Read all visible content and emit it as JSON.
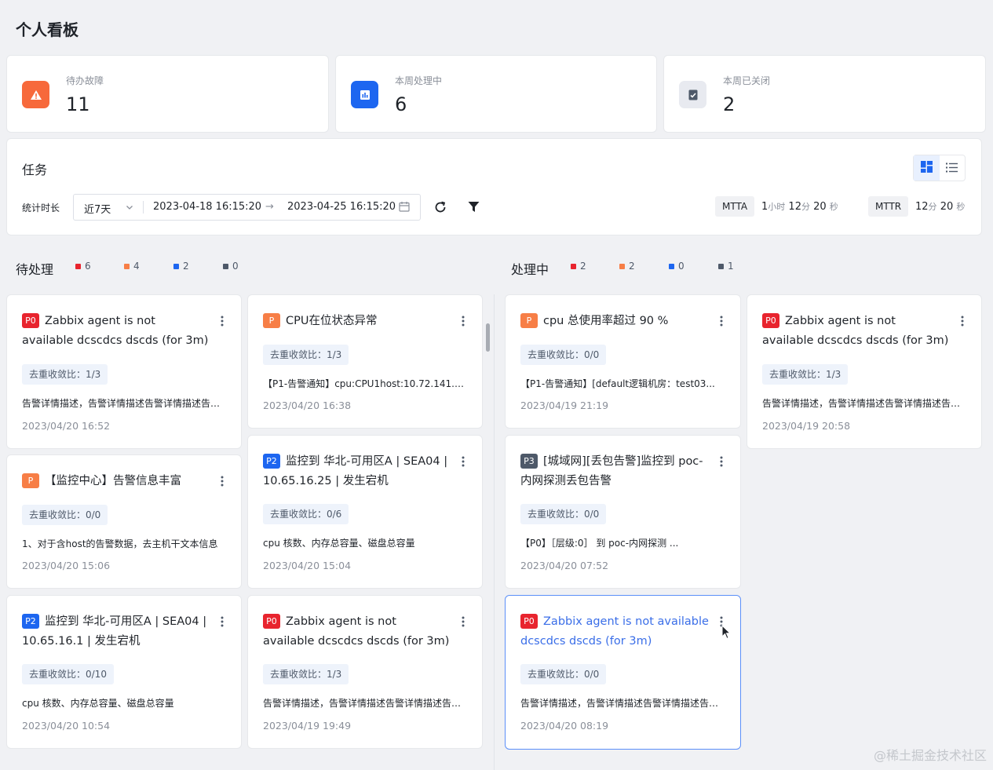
{
  "page_title": "个人看板",
  "stats": [
    {
      "label": "待办故障",
      "value": "11",
      "icon": "warning-icon",
      "color": "#f7693b"
    },
    {
      "label": "本周处理中",
      "value": "6",
      "icon": "chart-icon",
      "color": "#1d66f0"
    },
    {
      "label": "本周已关闭",
      "value": "2",
      "icon": "clipboard-check-icon",
      "color": "#e8eaf0"
    }
  ],
  "task": {
    "title": "任务",
    "filter_label": "统计时长",
    "range_select": "近7天",
    "start": "2023-04-18 16:15:20",
    "arrow": "→",
    "end": "2023-04-25 16:15:20",
    "mtta_label": "MTTA",
    "mtta": {
      "h": "1",
      "h_unit": "小时",
      "m": "12",
      "m_unit": "分",
      "s": "20",
      "s_unit": "秒"
    },
    "mttr_label": "MTTR",
    "mttr": {
      "m": "12",
      "m_unit": "分",
      "s": "20",
      "s_unit": "秒"
    }
  },
  "columns": [
    {
      "title": "待处理",
      "legend": [
        "6",
        "4",
        "2",
        "0"
      ]
    },
    {
      "title": "处理中",
      "legend": [
        "2",
        "2",
        "0",
        "1"
      ]
    }
  ],
  "legend_colors": [
    "#e8242e",
    "#f77e46",
    "#1d66f0",
    "#4e5969"
  ],
  "cards": [
    {
      "badge": "P0",
      "title": "Zabbix agent is not available dcscdcs dscds (for 3m)",
      "dedup": "去重收敛比：1/3",
      "desc": "告警详情描述，告警详情描述告警详情描述告警详情描述",
      "time": "2023/04/20 16:52"
    },
    {
      "badge": "P",
      "title": "CPU在位状态异常",
      "dedup": "去重收敛比：1/3",
      "desc": "【P1-告警通知】cpu:CPU1host:10.72.141.1...",
      "time": "2023/04/20 16:38"
    },
    {
      "badge": "P",
      "title": "【监控中心】告警信息丰富",
      "dedup": "去重收敛比：0/0",
      "desc": "1、对于含host的告警数据，去主机干文本信息",
      "time": "2023/04/20 15:06"
    },
    {
      "badge": "P2",
      "title": "监控到 华北-可用区A | SEA04 | 10.65.16.25 | 发生宕机",
      "dedup": "去重收敛比：0/6",
      "desc": "cpu 核数、内存总容量、磁盘总容量",
      "time": "2023/04/20 15:04"
    },
    {
      "badge": "P2",
      "title": "监控到 华北-可用区A | SEA04 | 10.65.16.1 | 发生宕机",
      "dedup": "去重收敛比：0/10",
      "desc": "cpu 核数、内存总容量、磁盘总容量",
      "time": "2023/04/20 10:54"
    },
    {
      "badge": "P0",
      "title": "Zabbix agent is not available dcscdcs dscds (for 3m)",
      "dedup": "去重收敛比：1/3",
      "desc": "告警详情描述，告警详情描述告警详情描述告警详情描述",
      "time": "2023/04/19 19:49"
    },
    {
      "badge": "P",
      "title": "cpu 总使用率超过 90 %",
      "dedup": "去重收敛比：0/0",
      "desc": "【P1-告警通知】[default逻辑机房：test03...",
      "time": "2023/04/19 21:19"
    },
    {
      "badge": "P3",
      "title": "[城域网][丢包告警]监控到 poc-内网探测丢包告警",
      "dedup": "去重收敛比：0/0",
      "desc": "【P0】［层级:0］ 到 poc-内网探测 ...",
      "time": "2023/04/20 07:52"
    },
    {
      "badge": "P0",
      "title": "Zabbix agent is not available dcscdcs dscds (for 3m)",
      "dedup": "去重收敛比：0/0",
      "desc": "告警详情描述，告警详情描述告警详情描述告警详情描述",
      "time": "2023/04/20 08:19"
    },
    {
      "badge": "P0",
      "title": "Zabbix agent is not available dcscdcs dscds (for 3m)",
      "dedup": "去重收敛比：1/3",
      "desc": "告警详情描述，告警详情描述告警详情描述告警详情描述",
      "time": "2023/04/19 20:58"
    }
  ],
  "watermark": "@稀土掘金技术社区"
}
